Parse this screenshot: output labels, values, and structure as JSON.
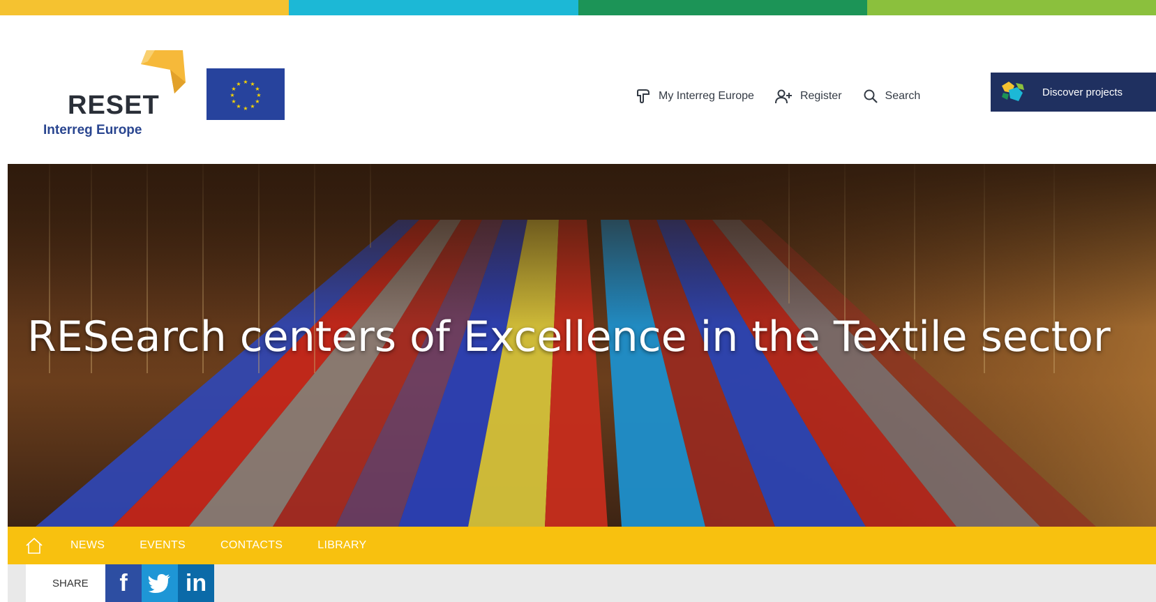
{
  "colors": {
    "stripe": [
      "#f5c230",
      "#1cb8d6",
      "#1c9457",
      "#8bc03d"
    ],
    "accent_yellow": "#f8c10f",
    "navy": "#1f3060",
    "eu_blue": "#27439d"
  },
  "logo": {
    "word": "RESET",
    "sub": "Interreg Europe"
  },
  "topnav": {
    "my_interreg": "My Interreg Europe",
    "register": "Register",
    "search": "Search",
    "discover": "Discover projects"
  },
  "hero": {
    "title": "RESearch centers of Excellence in the Textile sector"
  },
  "subnav": {
    "items": [
      "NEWS",
      "EVENTS",
      "CONTACTS",
      "LIBRARY"
    ]
  },
  "share": {
    "label": "SHARE",
    "facebook": "f",
    "linkedin": "in"
  },
  "icons": {
    "home": "home-icon",
    "my_interreg": "hand-icon",
    "register": "user-plus-icon",
    "search": "search-icon",
    "discover": "map-icon",
    "twitter": "twitter-icon"
  }
}
